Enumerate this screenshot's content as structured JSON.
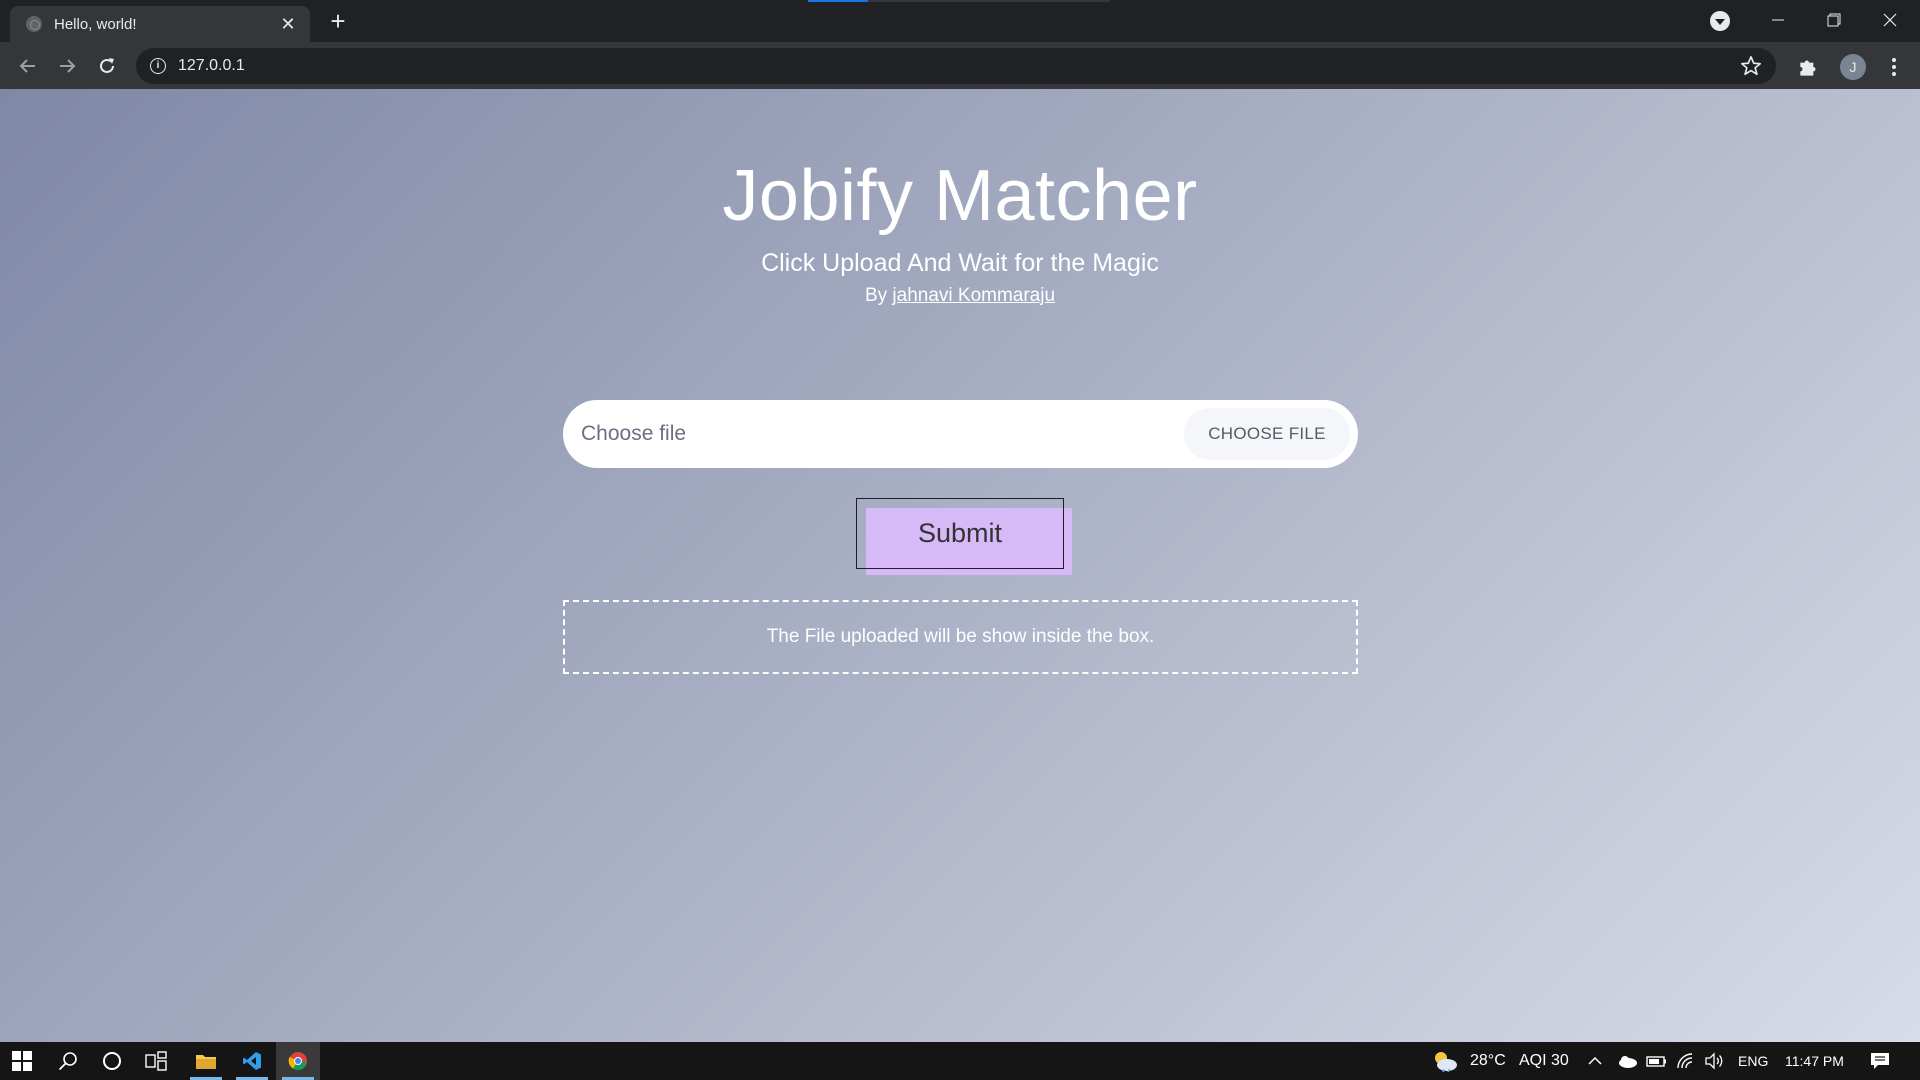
{
  "browser": {
    "tab_title": "Hello, world!",
    "url": "127.0.0.1",
    "avatar_letter": "J"
  },
  "page": {
    "title": "Jobify Matcher",
    "subtitle": "Click Upload And Wait for the Magic",
    "byline_prefix": "By",
    "author": "jahnavi Kommaraju",
    "file_placeholder": "Choose file",
    "choose_file_label": "CHOOSE FILE",
    "submit_label": "Submit",
    "dropbox_text": "The File uploaded will be show inside the box."
  },
  "taskbar": {
    "weather": "28°C",
    "aqi": "AQI 30",
    "language": "ENG",
    "time": "11:47 PM"
  },
  "colors": {
    "submit_fill": "#d7b9f7",
    "gradient_start": "#7f88a6",
    "gradient_end": "#d8dce8"
  }
}
